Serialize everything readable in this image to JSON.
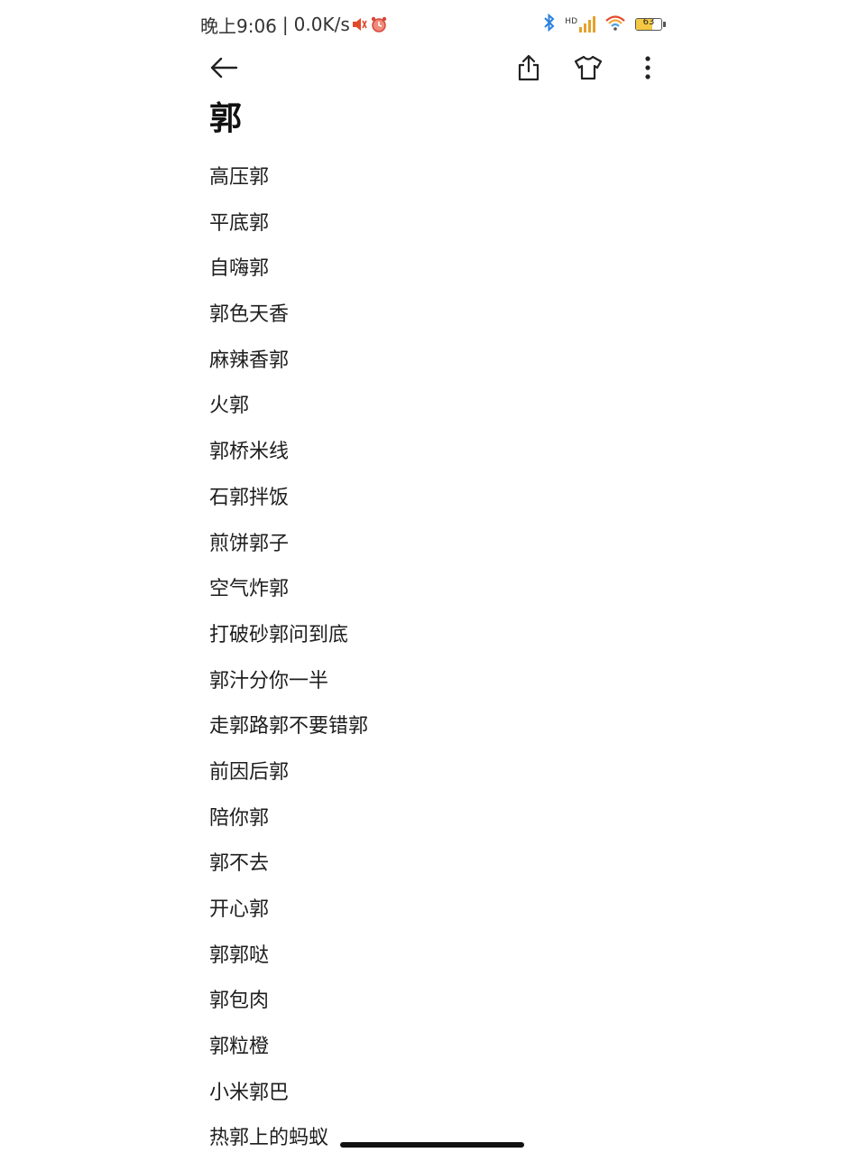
{
  "status_bar": {
    "time": "晚上9:06",
    "separator": "|",
    "net_speed": "0.0K/s",
    "hd_label": "HD",
    "battery_level": 63,
    "battery_text": "63"
  },
  "icons": {
    "back": "back-arrow-icon",
    "share": "share-icon",
    "theme": "tshirt-icon",
    "more": "more-vertical-icon"
  },
  "colors": {
    "bluetooth": "#2a7fe0",
    "signal": "#e4a22b",
    "battery_fill": "#f4c842"
  },
  "note": {
    "title": "郭",
    "items": [
      "高压郭",
      "平底郭",
      "自嗨郭",
      "郭色天香",
      "麻辣香郭",
      "火郭",
      "郭桥米线",
      "石郭拌饭",
      "煎饼郭子",
      "空气炸郭",
      "打破砂郭问到底",
      "郭汁分你一半",
      "走郭路郭不要错郭",
      "前因后郭",
      "陪你郭",
      "郭不去",
      "开心郭",
      "郭郭哒",
      "郭包肉",
      "郭粒橙",
      "小米郭巴",
      "热郭上的蚂蚁"
    ]
  }
}
